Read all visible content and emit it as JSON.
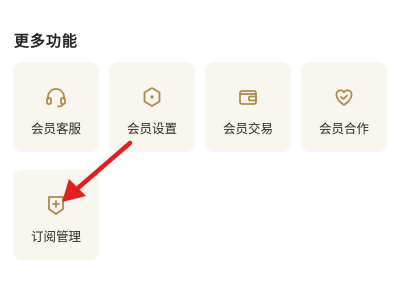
{
  "section": {
    "title": "更多功能"
  },
  "tiles": [
    {
      "label": "会员客服",
      "icon": "headset-icon"
    },
    {
      "label": "会员设置",
      "icon": "hexagon-settings-icon"
    },
    {
      "label": "会员交易",
      "icon": "wallet-icon"
    },
    {
      "label": "会员合作",
      "icon": "heart-handshake-icon"
    },
    {
      "label": "订阅管理",
      "icon": "subscription-add-icon"
    }
  ],
  "colors": {
    "icon_gold": "#b08a4a",
    "tile_bg": "#f8f6ef",
    "annotation_arrow": "#e02020"
  }
}
